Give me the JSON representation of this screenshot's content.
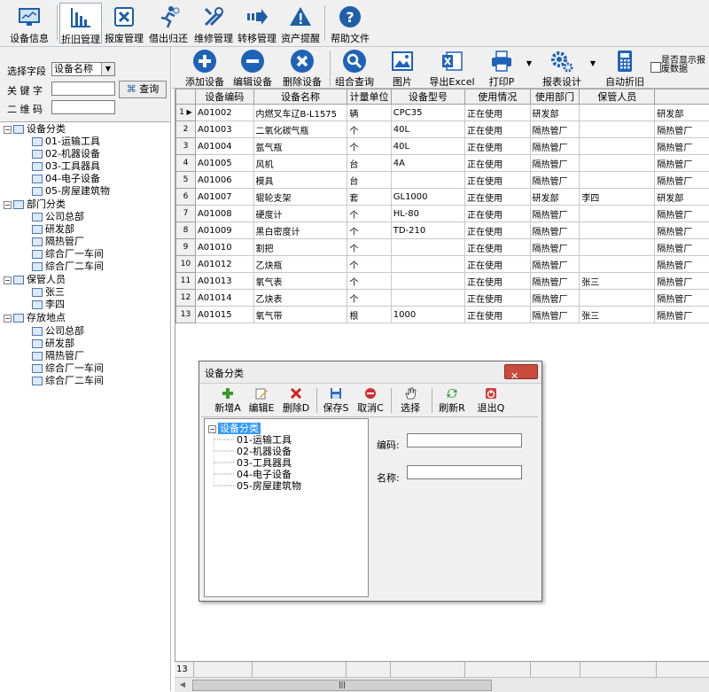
{
  "top_toolbar": [
    {
      "label": "设备信息",
      "icon": "monitor-icon"
    },
    {
      "label": "折旧管理",
      "icon": "chart-icon"
    },
    {
      "label": "报废管理",
      "icon": "scrap-icon"
    },
    {
      "label": "借出归还",
      "icon": "runner-icon"
    },
    {
      "label": "维修管理",
      "icon": "tools-icon"
    },
    {
      "label": "转移管理",
      "icon": "arrow-right-icon"
    },
    {
      "label": "资产提醒",
      "icon": "warning-icon"
    },
    {
      "label": "帮助文件",
      "icon": "help-icon"
    }
  ],
  "search": {
    "field_label": "选择字段",
    "field_value": "设备名称",
    "keyword_label": "关 键 字",
    "keyword_value": "",
    "barcode_label": "二 维 码",
    "barcode_value": "",
    "query_button": "查询"
  },
  "tree": [
    {
      "label": "设备分类",
      "level": 0
    },
    {
      "label": "01-运输工具",
      "level": 1
    },
    {
      "label": "02-机器设备",
      "level": 1
    },
    {
      "label": "03-工具器具",
      "level": 1
    },
    {
      "label": "04-电子设备",
      "level": 1
    },
    {
      "label": "05-房屋建筑物",
      "level": 1
    },
    {
      "label": "部门分类",
      "level": 0
    },
    {
      "label": "公司总部",
      "level": 1
    },
    {
      "label": "研发部",
      "level": 1
    },
    {
      "label": "隔热管厂",
      "level": 1
    },
    {
      "label": "综合厂一车间",
      "level": 1
    },
    {
      "label": "综合厂二车间",
      "level": 1
    },
    {
      "label": "保管人员",
      "level": 0
    },
    {
      "label": "张三",
      "level": 1
    },
    {
      "label": "李四",
      "level": 1
    },
    {
      "label": "存放地点",
      "level": 0
    },
    {
      "label": "公司总部",
      "level": 1
    },
    {
      "label": "研发部",
      "level": 1
    },
    {
      "label": "隔热管厂",
      "level": 1
    },
    {
      "label": "综合厂一车间",
      "level": 1
    },
    {
      "label": "综合厂二车间",
      "level": 1
    }
  ],
  "right_toolbar": [
    {
      "label": "添加设备",
      "icon": "plus-circle-icon"
    },
    {
      "label": "编辑设备",
      "icon": "minus-circle-icon"
    },
    {
      "label": "删除设备",
      "icon": "x-circle-icon"
    },
    {
      "label": "组合查询",
      "icon": "magnifier-icon"
    },
    {
      "label": "图片",
      "icon": "picture-icon"
    },
    {
      "label": "导出Excel",
      "icon": "excel-icon"
    },
    {
      "label": "打印P",
      "icon": "printer-icon"
    },
    {
      "label": "报表设计",
      "icon": "gear-icon"
    },
    {
      "label": "自动折旧",
      "icon": "calculator-icon"
    }
  ],
  "display_checkbox_label": "是否显示报废数据",
  "grid": {
    "headers": [
      "设备编码",
      "设备名称",
      "计量单位",
      "设备型号",
      "使用情况",
      "使用部门",
      "保管人员",
      ""
    ],
    "rows": [
      [
        "1",
        "A01002",
        "内燃叉车辽B-L1575",
        "辆",
        "CPC35",
        "正在使用",
        "研发部",
        "",
        "研发部"
      ],
      [
        "2",
        "A01003",
        "二氧化碳气瓶",
        "个",
        "40L",
        "正在使用",
        "隔热管厂",
        "",
        "隔热管厂"
      ],
      [
        "3",
        "A01004",
        "氩气瓶",
        "个",
        "40L",
        "正在使用",
        "隔热管厂",
        "",
        "隔热管厂"
      ],
      [
        "4",
        "A01005",
        "风机",
        "台",
        "4A",
        "正在使用",
        "隔热管厂",
        "",
        "隔热管厂"
      ],
      [
        "5",
        "A01006",
        "模具",
        "台",
        "",
        "正在使用",
        "隔热管厂",
        "",
        "隔热管厂"
      ],
      [
        "6",
        "A01007",
        "辊轮支架",
        "套",
        "GL1000",
        "正在使用",
        "研发部",
        "李四",
        "研发部"
      ],
      [
        "7",
        "A01008",
        "硬度计",
        "个",
        "HL-80",
        "正在使用",
        "隔热管厂",
        "",
        "隔热管厂"
      ],
      [
        "8",
        "A01009",
        "黑白密度计",
        "个",
        "TD-210",
        "正在使用",
        "隔热管厂",
        "",
        "隔热管厂"
      ],
      [
        "9",
        "A01010",
        "割把",
        "个",
        "",
        "正在使用",
        "隔热管厂",
        "",
        "隔热管厂"
      ],
      [
        "10",
        "A01012",
        "乙炔瓶",
        "个",
        "",
        "正在使用",
        "隔热管厂",
        "",
        "隔热管厂"
      ],
      [
        "11",
        "A01013",
        "氧气表",
        "个",
        "",
        "正在使用",
        "隔热管厂",
        "张三",
        "隔热管厂"
      ],
      [
        "12",
        "A01014",
        "乙炔表",
        "个",
        "",
        "正在使用",
        "隔热管厂",
        "",
        "隔热管厂"
      ],
      [
        "13",
        "A01015",
        "氧气带",
        "根",
        "1000",
        "正在使用",
        "隔热管厂",
        "张三",
        "隔热管厂"
      ]
    ],
    "footer_count": "13"
  },
  "dialog": {
    "title": "设备分类",
    "buttons": [
      {
        "label": "新增A",
        "icon": "add-icon"
      },
      {
        "label": "编辑E",
        "icon": "edit-icon"
      },
      {
        "label": "删除D",
        "icon": "delete-icon"
      },
      {
        "label": "保存S",
        "icon": "save-icon"
      },
      {
        "label": "取消C",
        "icon": "cancel-icon"
      },
      {
        "label": "选择",
        "icon": "hand-icon"
      },
      {
        "label": "刷新R",
        "icon": "refresh-icon"
      },
      {
        "label": "退出Q",
        "icon": "exit-icon"
      }
    ],
    "tree_root": "设备分类",
    "tree_items": [
      "01-运输工具",
      "02-机器设备",
      "03-工具器具",
      "04-电子设备",
      "05-房屋建筑物"
    ],
    "code_label": "编码:",
    "code_value": "",
    "name_label": "名称:",
    "name_value": ""
  },
  "colors": {
    "accent": "#1f6fc5",
    "selection": "#3399ff",
    "close": "#c94b3e"
  }
}
